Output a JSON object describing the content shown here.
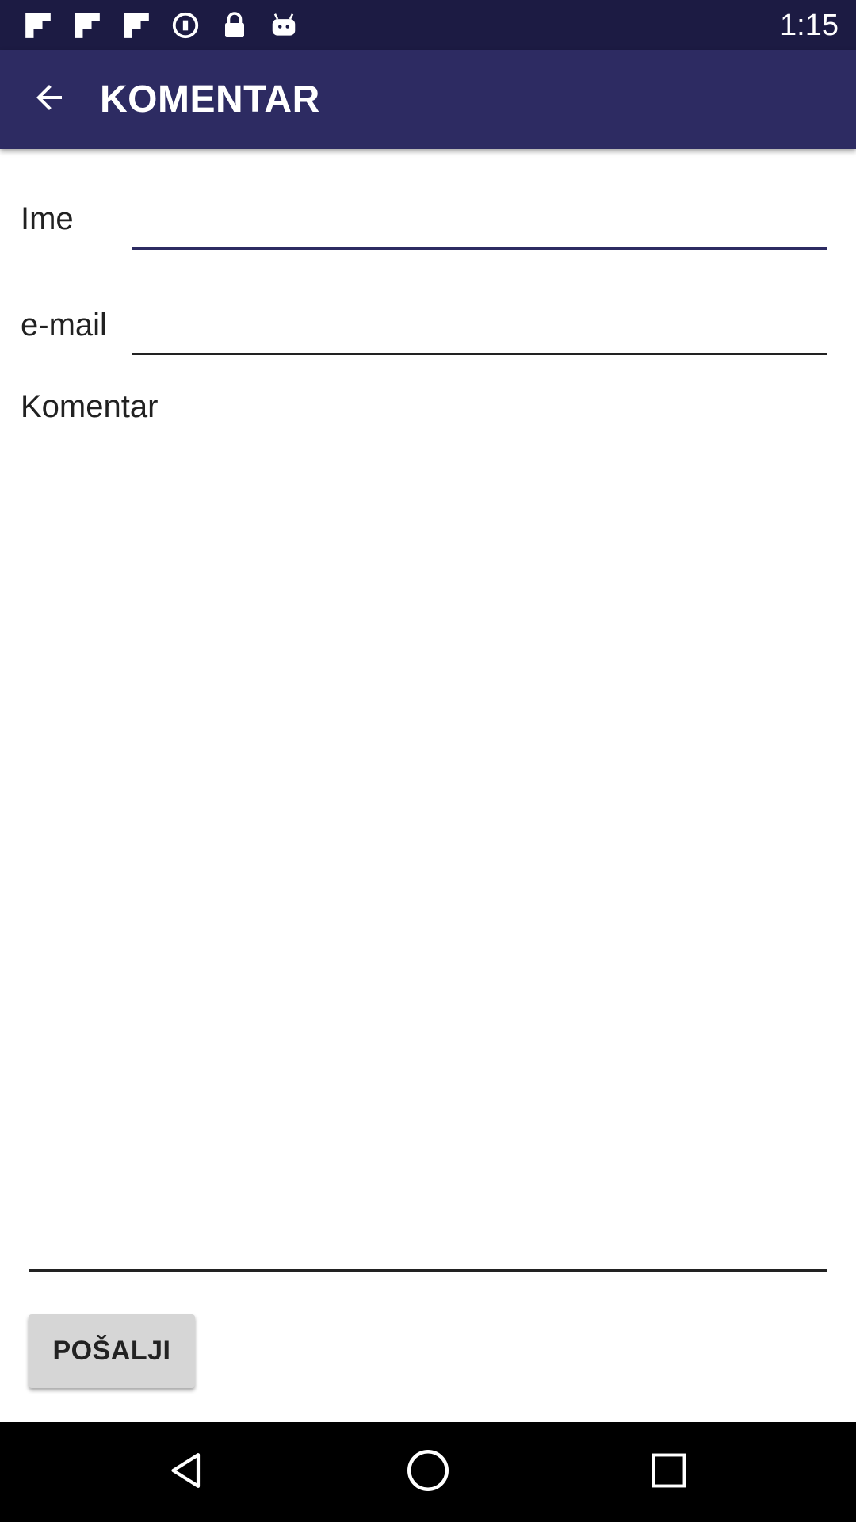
{
  "status_bar": {
    "time": "1:15",
    "icons": [
      "flipboard-icon",
      "flipboard-icon",
      "flipboard-icon",
      "vpn-key-icon",
      "lock-icon",
      "android-icon"
    ]
  },
  "app_bar": {
    "title": "KOMENTAR",
    "back_icon": "arrow-back-icon",
    "color": "#2d2b62"
  },
  "form": {
    "name": {
      "label": "Ime",
      "value": "",
      "focused": true,
      "accent": "#2d2b62"
    },
    "email": {
      "label": "e-mail",
      "value": ""
    },
    "comment": {
      "label": "Komentar",
      "value": ""
    },
    "submit_label": "POŠALJI"
  },
  "nav_bar": {
    "buttons": [
      "back-triangle-icon",
      "home-circle-icon",
      "recents-square-icon"
    ]
  }
}
